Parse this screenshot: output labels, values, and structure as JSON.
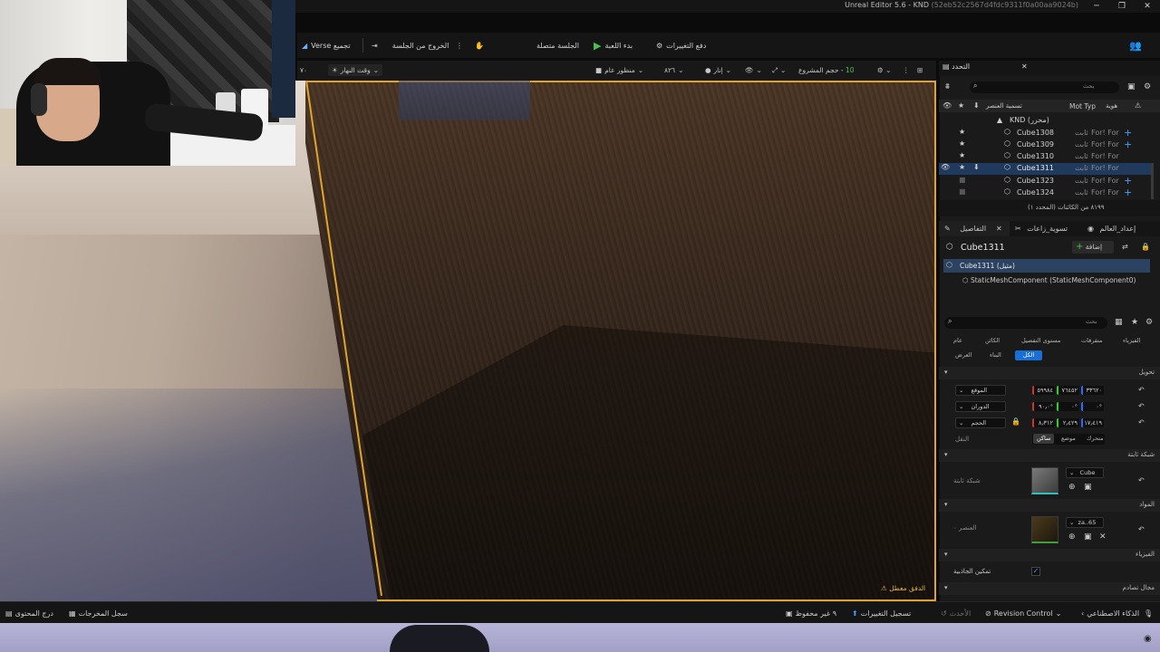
{
  "app": {
    "title": "Unreal Editor 5.6 - KND",
    "hash": "(52eb52c2567d4fdc9311f0a00aa9024b)"
  },
  "window_controls": {
    "minimize": "─",
    "maximize": "❐",
    "close": "✕"
  },
  "toolbar": {
    "compile_label": "Verse تجميع",
    "exit_session_label": "الخروج من الجلسة",
    "session_connected_label": "الجلسة متصلة",
    "start_game_label": "بدء اللعبة",
    "push_changes_label": "دفع التغييرات"
  },
  "viewport_toolbar": {
    "time_of_day": "وقت النهار",
    "num_left": "٧٠",
    "perspective": "منظور عام",
    "fov": "٨٢٦",
    "lit": "إنار",
    "project_size": "حجم المشروع -",
    "grid_value": "10",
    "warning": "الدفق معطل"
  },
  "outliner": {
    "tab_label": "التحدد",
    "search_placeholder": "بحث",
    "col_label": "تسمية العنصر",
    "col_type": "Mot Typ",
    "col_id": "هوية",
    "root_label": "KND (محرر)",
    "rows": [
      {
        "name": "Cube1308",
        "kind": "ثابت",
        "for": "For! For"
      },
      {
        "name": "Cube1309",
        "kind": "ثابت",
        "for": "For! For"
      },
      {
        "name": "Cube1310",
        "kind": "ثابت",
        "for": "For! For"
      },
      {
        "name": "Cube1311",
        "kind": "ثابت",
        "for": "For! For"
      },
      {
        "name": "Cube1323",
        "kind": "ثابت",
        "for": "For! For"
      },
      {
        "name": "Cube1324",
        "kind": "ثابت",
        "for": "For! For"
      }
    ],
    "count_text": "٨١٩٩ من الكائنات (المحدد ١)"
  },
  "details": {
    "tab_details": "التفاصيل",
    "tab_settings": "تسوية_زاعات",
    "tab_world": "إعداد_العالم",
    "actor_name": "Cube1311",
    "add_label": "إضافة",
    "instance_label": "Cube1311 (مثيل)",
    "component_label": "StaticMeshComponent (StaticMeshComponent0)",
    "search_placeholder": "بحث",
    "filters_row1": [
      "الفيزياء",
      "متفرقات",
      "مستوى التفصيل",
      "الكائن",
      "عام"
    ],
    "filters_row2": [
      "الكل",
      "البناء",
      "العرض"
    ],
    "transform_section": "تحويل",
    "location_label": "الموقع",
    "rotation_label": "الدوران",
    "scale_label": "الحجم",
    "location": [
      "٥٩٩٨٤",
      "٧٦٤٥٢",
      "٣٣٦٢٠"
    ],
    "rotation": [
      "٩٠٫٠°",
      "٠°",
      "٠°"
    ],
    "scale": [
      "٨٫٣١٢",
      "٢٫٤٢٩",
      "١٧٫٤١٩"
    ],
    "mobility_label": "النقل",
    "mobility_options": [
      "متحرك",
      "موضع",
      "ساكن"
    ],
    "static_mesh_section": "شبكة ثابتة",
    "static_mesh_label": "شبكة ثابتة",
    "mesh_value": "Cube",
    "materials_section": "المواد",
    "element_label": "العنصر ٠",
    "material_value": "za..65",
    "physics_section": "الفيزياء",
    "gravity_label": "تمكين الجاذبية",
    "collision_section": "مجال تصادم"
  },
  "statusbar": {
    "content_drawer": "درج المحتوى",
    "output_log": "سجل المخرجات",
    "unsaved": "٩ غير محفوظ",
    "check_in": "تسجيل التغييرات",
    "latest": "الأحدث",
    "revision_control": "Revision Control",
    "ai": "الذكاء الاصطناعي"
  },
  "colors": {
    "accent": "#1a6fd6",
    "selection": "#e0a42a",
    "play_green": "#4bc04b"
  }
}
